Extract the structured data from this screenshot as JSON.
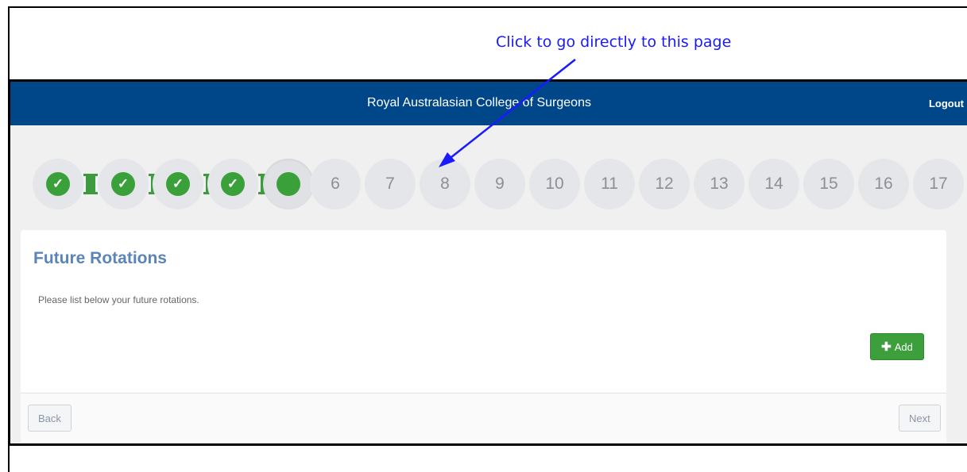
{
  "annotation": {
    "text": "Click to go directly to this page"
  },
  "header": {
    "title": "Royal Australasian College of Surgeons",
    "logout_label": "Logout"
  },
  "progress": {
    "completed_steps": 4,
    "current_step": 5,
    "steps": [
      "6",
      "7",
      "8",
      "9",
      "10",
      "11",
      "12",
      "13",
      "14",
      "15",
      "16",
      "17"
    ]
  },
  "panel": {
    "title": "Future Rotations",
    "instruction": "Please list below your future rotations.",
    "add_label": "Add",
    "add_icon": "plus-icon"
  },
  "footer": {
    "back_label": "Back",
    "next_label": "Next"
  },
  "colors": {
    "header_bg": "#00478a",
    "step_complete": "#3aa13a",
    "title": "#5b84b8",
    "annotation": "#1a1aff"
  }
}
